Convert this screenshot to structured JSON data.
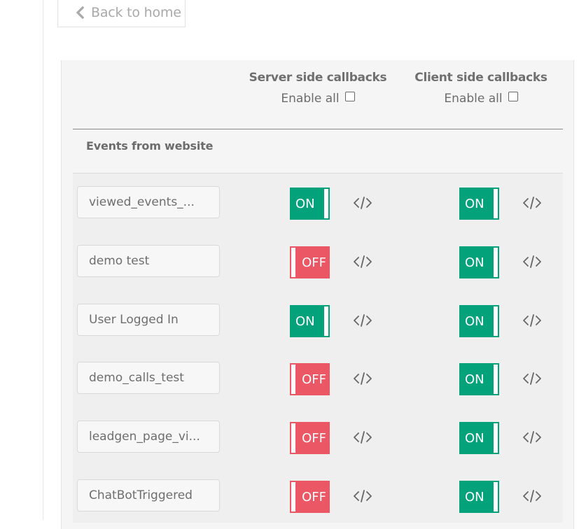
{
  "back_button": {
    "label": "Back to home"
  },
  "columns": {
    "server": {
      "title": "Server side callbacks",
      "enable_all_label": "Enable all",
      "enable_all_checked": false
    },
    "client": {
      "title": "Client side callbacks",
      "enable_all_label": "Enable all",
      "enable_all_checked": false
    }
  },
  "section": {
    "title": "Events from website"
  },
  "events": [
    {
      "name": "viewed_events_...",
      "server": "ON",
      "client": "ON"
    },
    {
      "name": "demo test",
      "server": "OFF",
      "client": "ON"
    },
    {
      "name": "User Logged In",
      "server": "ON",
      "client": "ON"
    },
    {
      "name": "demo_calls_test",
      "server": "OFF",
      "client": "ON"
    },
    {
      "name": "leadgen_page_vi...",
      "server": "OFF",
      "client": "ON"
    },
    {
      "name": "ChatBotTriggered",
      "server": "OFF",
      "client": "ON"
    }
  ],
  "colors": {
    "on": "#04a27a",
    "off": "#ec5765"
  },
  "icons": {
    "back": "chevron-left-icon",
    "code": "code-icon"
  }
}
